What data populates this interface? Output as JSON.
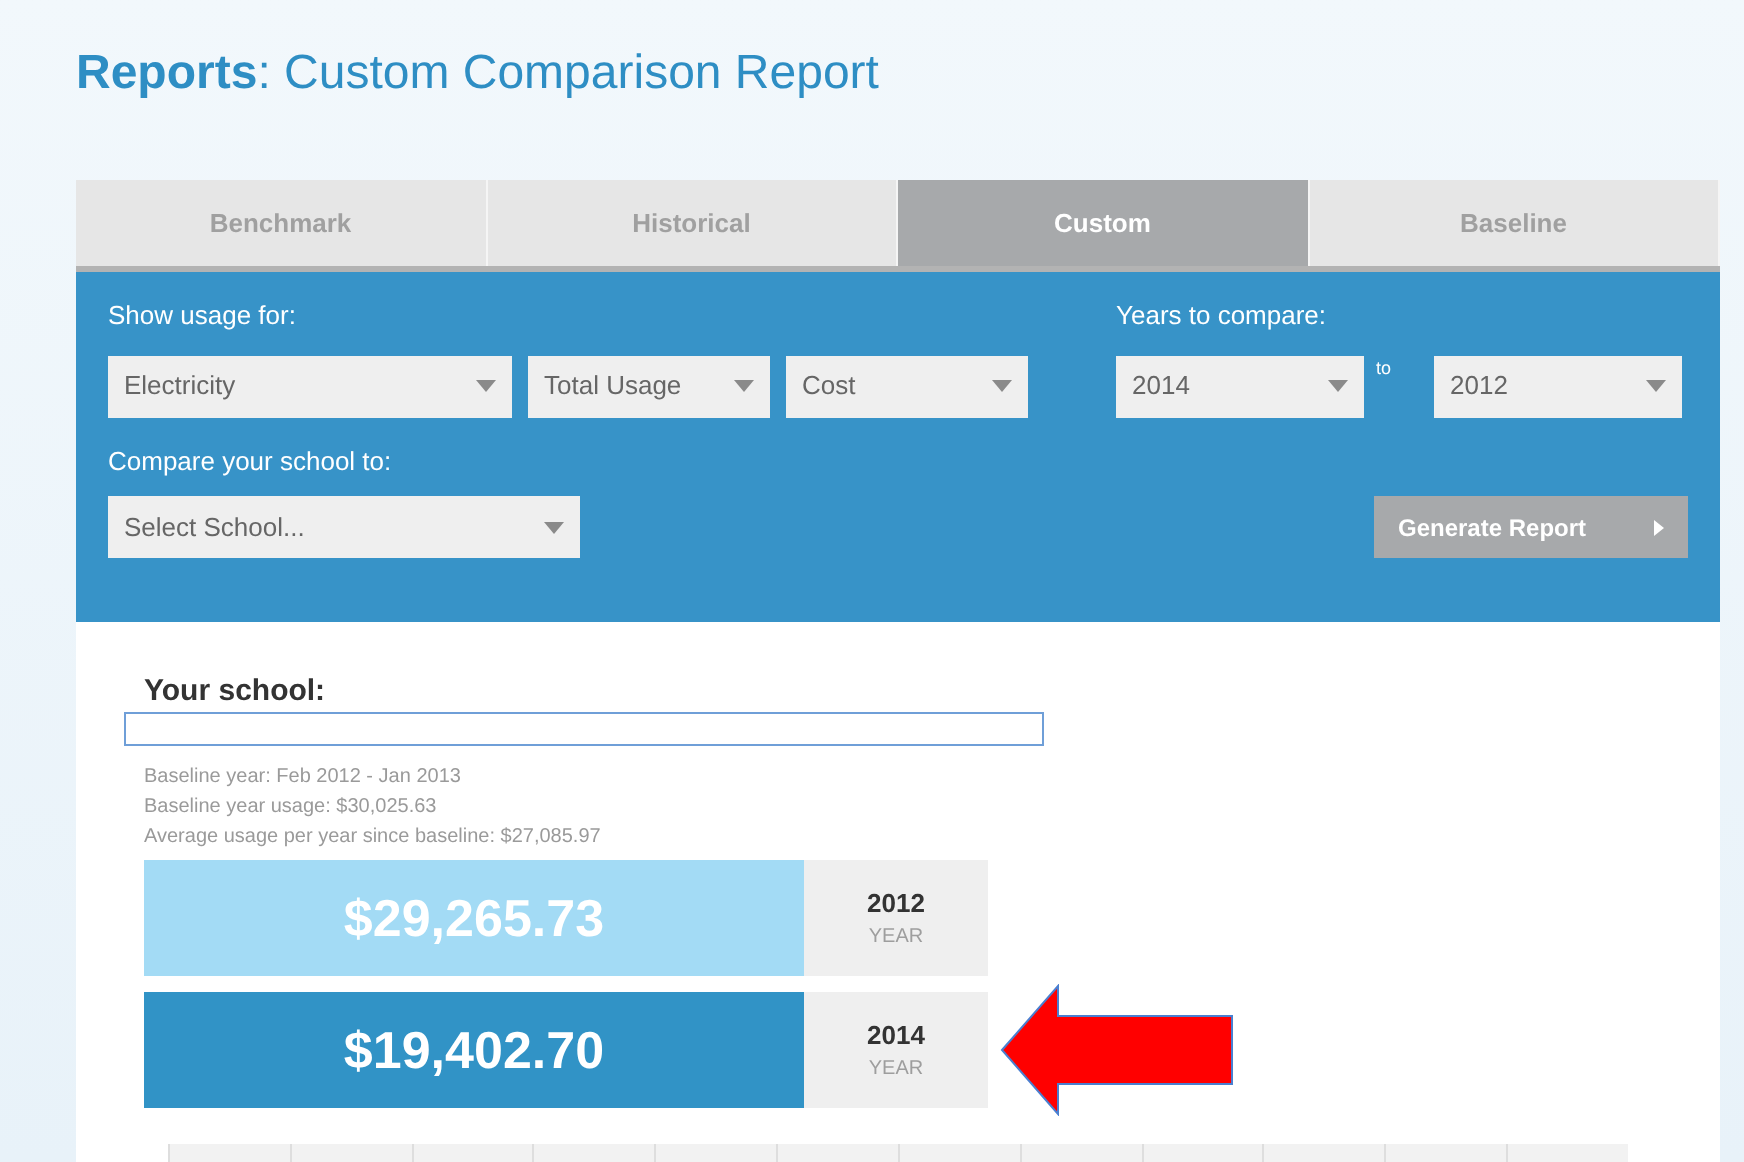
{
  "page_title": {
    "bold": "Reports",
    "rest": ": Custom Comparison Report"
  },
  "tabs": [
    {
      "label": "Benchmark",
      "selected": false
    },
    {
      "label": "Historical",
      "selected": false
    },
    {
      "label": "Custom",
      "selected": true
    },
    {
      "label": "Baseline",
      "selected": false
    }
  ],
  "filters": {
    "usage_label": "Show usage for:",
    "usage_selects": [
      "Electricity",
      "Total Usage",
      "Cost"
    ],
    "years_label": "Years to compare:",
    "year_from": "2014",
    "to_label": "to",
    "year_to": "2012",
    "compare_label": "Compare your school to:",
    "school_select": {
      "placeholder": "Select School..."
    },
    "generate_button": "Generate Report"
  },
  "school": {
    "heading": "Your school:",
    "details": [
      "Baseline year: Feb 2012 - Jan 2013",
      "Baseline year usage: $30,025.63",
      "Average usage per year since baseline: $27,085.97"
    ]
  },
  "comparisons": [
    {
      "amount": "$29,265.73",
      "year": "2012",
      "unit": "YEAR",
      "color": "#a3dbf5",
      "highlighted": false
    },
    {
      "amount": "$19,402.70",
      "year": "2014",
      "unit": "YEAR",
      "color": "#3193c6",
      "highlighted": true
    }
  ]
}
